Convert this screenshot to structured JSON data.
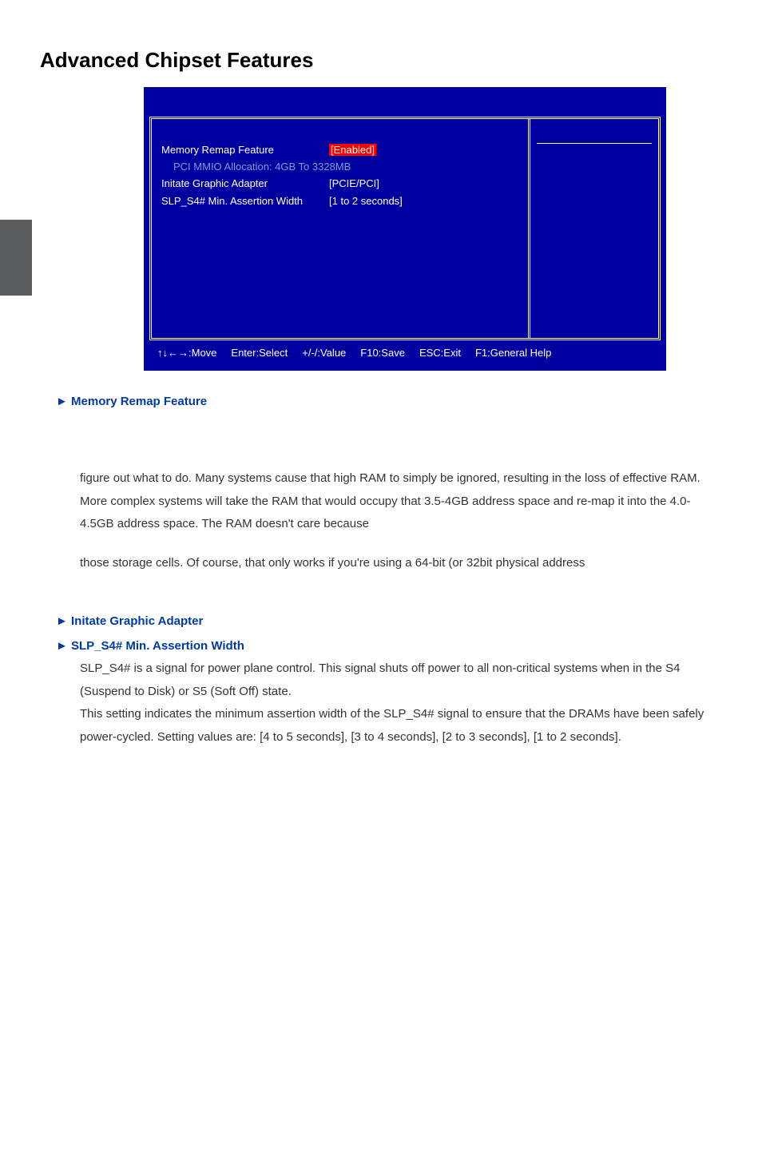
{
  "page": {
    "title": "Advanced Chipset Features"
  },
  "bios": {
    "rows": {
      "memory_remap": {
        "label": "Memory Remap Feature",
        "value": "[Enabled]"
      },
      "pci_mmio": {
        "label": "PCI MMIO Allocation: 4GB To 3328MB"
      },
      "initate_graphic": {
        "label": "Initate Graphic Adapter",
        "value": "[PCIE/PCI]"
      },
      "slp_s4": {
        "label": "SLP_S4# Min. Assertion Width",
        "value": "[1 to 2 seconds]"
      }
    },
    "footer": {
      "move": "↑↓←→:Move",
      "select": "Enter:Select",
      "value": "+/-/:Value",
      "save": "F10:Save",
      "exit": "ESC:Exit",
      "help": "F1:General Help"
    }
  },
  "sections": {
    "memory_remap": {
      "heading": "► Memory Remap Feature",
      "para1": "figure out what to do.  Many systems cause that high RAM to simply be ignored, resulting in the loss of effective RAM.  More complex systems will take the RAM that would occupy that 3.5-4GB address space and re-map it into the 4.0-4.5GB address space. The RAM doesn't care because",
      "para2": "those storage cells. Of course, that only works if you're using a 64-bit (or 32bit physical address"
    },
    "initate_graphic": {
      "heading": "► Initate Graphic Adapter"
    },
    "slp_s4": {
      "heading": "► SLP_S4# Min. Assertion Width",
      "para": "SLP_S4# is a signal for power plane control. This signal shuts off power to all non-critical systems when in the S4 (Suspend to Disk) or S5 (Soft Off) state.\nThis setting indicates the minimum assertion width of the SLP_S4# signal to ensure that the DRAMs have been safely power-cycled. Setting values are: [4 to 5 seconds],  [3 to 4 seconds], [2 to 3 seconds],  [1 to 2 seconds]."
    }
  }
}
